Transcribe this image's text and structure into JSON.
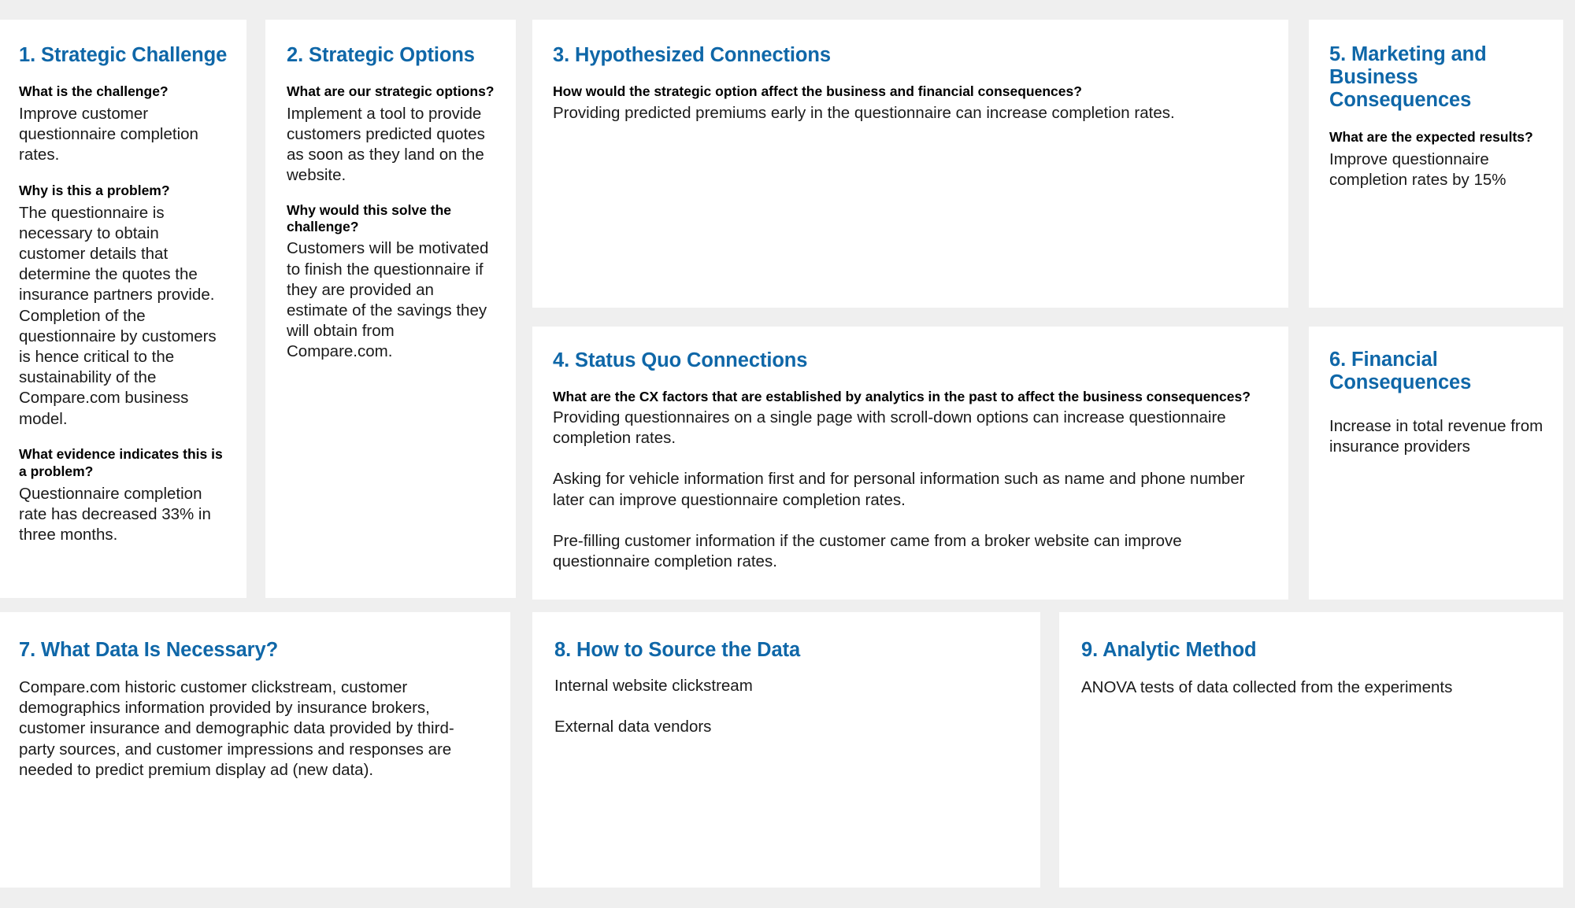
{
  "theme": {
    "accent_color": "#0f67a8",
    "card_background": "#ffffff",
    "page_background": "#efefef",
    "body_text_color": "#1a1a1a"
  },
  "cards": {
    "strategic_challenge": {
      "title": "1. Strategic Challenge",
      "q1": "What is the challenge?",
      "a1": "Improve customer questionnaire completion rates.",
      "q2": "Why is this a problem?",
      "a2": "The questionnaire is necessary to obtain customer details that determine the quotes the insurance partners provide. Completion of the questionnaire by customers is hence critical to the sustainability of the Compare.com business model.",
      "q3": "What evidence indicates this is a problem?",
      "a3": "Questionnaire completion rate has decreased 33% in three months."
    },
    "strategic_options": {
      "title": "2. Strategic Options",
      "q1": "What are our strategic options?",
      "a1": "Implement a tool to provide customers predicted quotes as soon as they land on the website.",
      "q2": "Why would this solve the challenge?",
      "a2": "Customers will be motivated to finish the questionnaire if they are provided an estimate of the savings they will obtain from Compare.com."
    },
    "hypothesized_connections": {
      "title": "3. Hypothesized Connections",
      "q1": "How would the strategic option affect the business and financial consequences?",
      "a1": "Providing predicted premiums early in the questionnaire can increase completion rates."
    },
    "status_quo_connections": {
      "title": "4. Status Quo Connections",
      "q1": "What are the CX factors that are established by analytics in the past to affect the business consequences?",
      "a1": "Providing questionnaires on a single page with scroll-down options can increase questionnaire completion rates.",
      "a2": "Asking for vehicle information first and for personal information such as name and phone number later can improve questionnaire completion rates.",
      "a3": "Pre-filling customer information if the customer came from a broker website can improve questionnaire completion rates."
    },
    "marketing_business_consequences": {
      "title": "5. Marketing and Business Consequences",
      "q1": "What are the expected results?",
      "a1": "Improve questionnaire completion rates by 15%"
    },
    "financial_consequences": {
      "title": "6. Financial Consequences",
      "a1": "Increase in total revenue from insurance providers"
    },
    "data_necessary": {
      "title": "7. What Data Is Necessary?",
      "a1": "Compare.com historic customer clickstream, customer demographics information provided by insurance brokers, customer insurance and demographic data provided by third-party sources, and customer impressions and responses are needed to predict premium display ad (new data)."
    },
    "source_the_data": {
      "title": "8. How to Source the Data",
      "a1": "Internal website clickstream",
      "a2": "External data vendors"
    },
    "analytic_method": {
      "title": "9. Analytic Method",
      "a1": "ANOVA tests of data collected from the experiments"
    }
  }
}
